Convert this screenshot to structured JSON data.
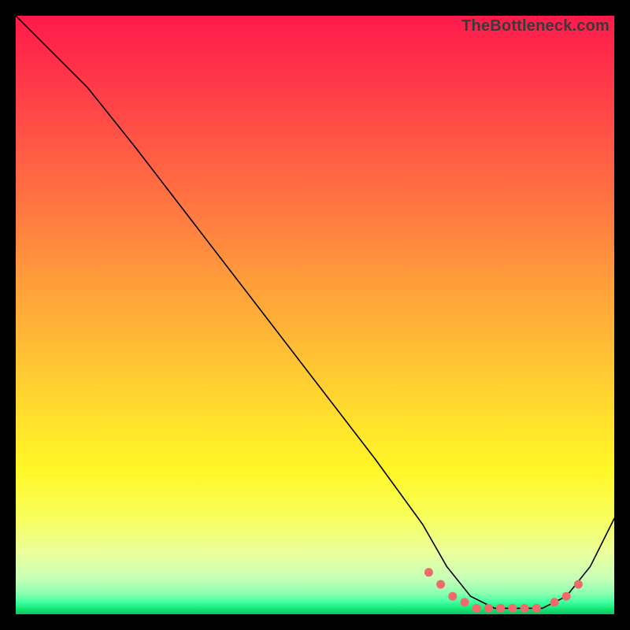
{
  "watermark": "TheBottleneck.com",
  "colors": {
    "dot": "#ef6b6b",
    "curve": "#000000",
    "frame": "#000000"
  },
  "chart_data": {
    "type": "line",
    "title": "",
    "xlabel": "",
    "ylabel": "",
    "xlim": [
      0,
      100
    ],
    "ylim": [
      0,
      100
    ],
    "grid": false,
    "legend": false,
    "series": [
      {
        "name": "bottleneck-curve",
        "x": [
          0,
          8,
          12,
          20,
          30,
          40,
          50,
          60,
          68,
          72,
          76,
          80,
          84,
          88,
          92,
          96,
          100
        ],
        "y": [
          100,
          92,
          88,
          78,
          65,
          52,
          39,
          26,
          15,
          8,
          3,
          1,
          1,
          1,
          3,
          8,
          16
        ]
      }
    ],
    "markers": {
      "name": "highlighted-points",
      "x": [
        69,
        71,
        73,
        75,
        77,
        79,
        81,
        83,
        85,
        87,
        90,
        92,
        94
      ],
      "y": [
        7,
        5,
        3,
        2,
        1,
        1,
        1,
        1,
        1,
        1,
        2,
        3,
        5
      ]
    }
  }
}
